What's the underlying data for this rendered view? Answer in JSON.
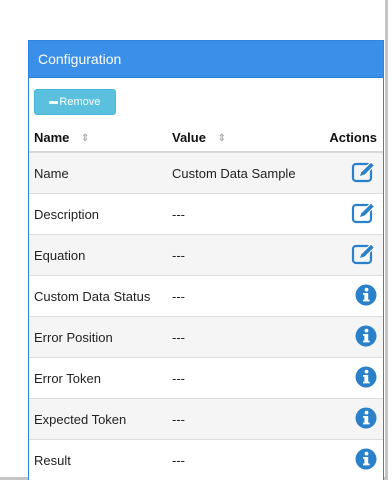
{
  "panel": {
    "title": "Configuration"
  },
  "toolbar": {
    "remove_label": "Remove",
    "remove_icon": "minus-icon"
  },
  "table": {
    "columns": [
      {
        "label": "Name",
        "sortable": true
      },
      {
        "label": "Value",
        "sortable": true
      },
      {
        "label": "Actions",
        "sortable": false
      }
    ],
    "rows": [
      {
        "name": "Name",
        "value": "Custom Data Sample",
        "action": "edit-icon"
      },
      {
        "name": "Description",
        "value": "---",
        "action": "edit-icon"
      },
      {
        "name": "Equation",
        "value": "---",
        "action": "edit-icon"
      },
      {
        "name": "Custom Data Status",
        "value": "---",
        "action": "info-icon"
      },
      {
        "name": "Error Position",
        "value": "---",
        "action": "info-icon"
      },
      {
        "name": "Error Token",
        "value": "---",
        "action": "info-icon"
      },
      {
        "name": "Expected Token",
        "value": "---",
        "action": "info-icon"
      },
      {
        "name": "Result",
        "value": "---",
        "action": "info-icon"
      }
    ]
  },
  "colors": {
    "header_bg": "#3a8fe8",
    "button_bg": "#5bc0de",
    "icon_blue": "#2a80c9"
  }
}
